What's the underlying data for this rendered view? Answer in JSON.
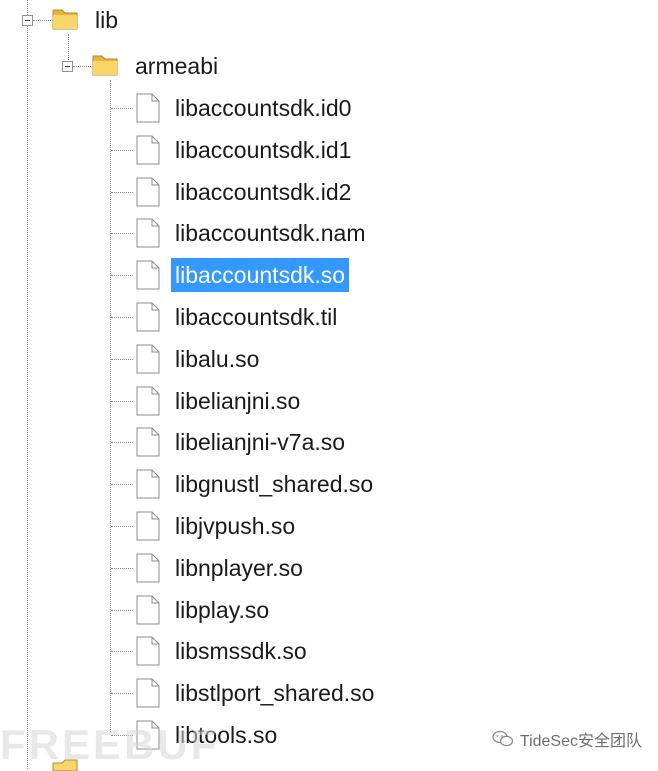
{
  "tree": {
    "root_folder": "lib",
    "sub_folder": "armeabi",
    "files": [
      "libaccountsdk.id0",
      "libaccountsdk.id1",
      "libaccountsdk.id2",
      "libaccountsdk.nam",
      "libaccountsdk.so",
      "libaccountsdk.til",
      "libalu.so",
      "libelianjni.so",
      "libelianjni-v7a.so",
      "libgnustl_shared.so",
      "libjvpush.so",
      "libnplayer.so",
      "libplay.so",
      "libsmssdk.so",
      "libstlport_shared.so",
      "libtools.so"
    ],
    "selected_index": 4
  },
  "watermark": {
    "text": "FREEBUF",
    "account": "TideSec安全团队"
  },
  "colors": {
    "selection": "#3399ff",
    "folder": "#f3c548"
  },
  "icons": {
    "folder": "folder-icon",
    "file": "file-icon",
    "expander": "collapse-icon",
    "wechat": "wechat-icon"
  }
}
